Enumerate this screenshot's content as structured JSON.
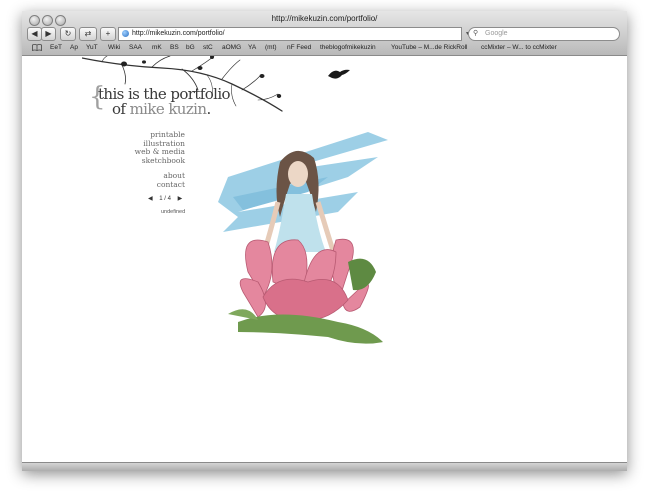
{
  "window": {
    "title": "http://mikekuzin.com/portfolio/"
  },
  "toolbar": {
    "back_icon": "back-arrow-icon",
    "forward_icon": "forward-arrow-icon",
    "reload_icon": "reload-icon",
    "url": "http://mikekuzin.com/portfolio/",
    "search_placeholder": "Google"
  },
  "bookmarks": [
    "EeT",
    "Ap",
    "YuT",
    "Wiki",
    "SAA",
    "mK",
    "BS",
    "bG",
    "stC",
    "aOMG",
    "YA",
    "(mt)",
    "nF Feed",
    "theblogofmikekuzin",
    "YouTube – M...de RickRoll",
    "ccMixter – W... to ccMixter"
  ],
  "site": {
    "logo_line1": "this is the portfolio",
    "logo_line2_prefix": "of",
    "logo_line2_name": "mike kuzin",
    "logo_line2_suffix": ".",
    "nav": [
      "printable",
      "illustration",
      "web & media",
      "sketchbook"
    ],
    "nav_secondary": [
      "about",
      "contact"
    ],
    "pager": {
      "prev_icon": "triangle-left-icon",
      "label": "1 / 4",
      "next_icon": "triangle-right-icon"
    },
    "status": "undefined"
  },
  "colors": {
    "sky": "#8cc7e2",
    "petal": "#e4879e",
    "leaf": "#6f9a4e"
  }
}
